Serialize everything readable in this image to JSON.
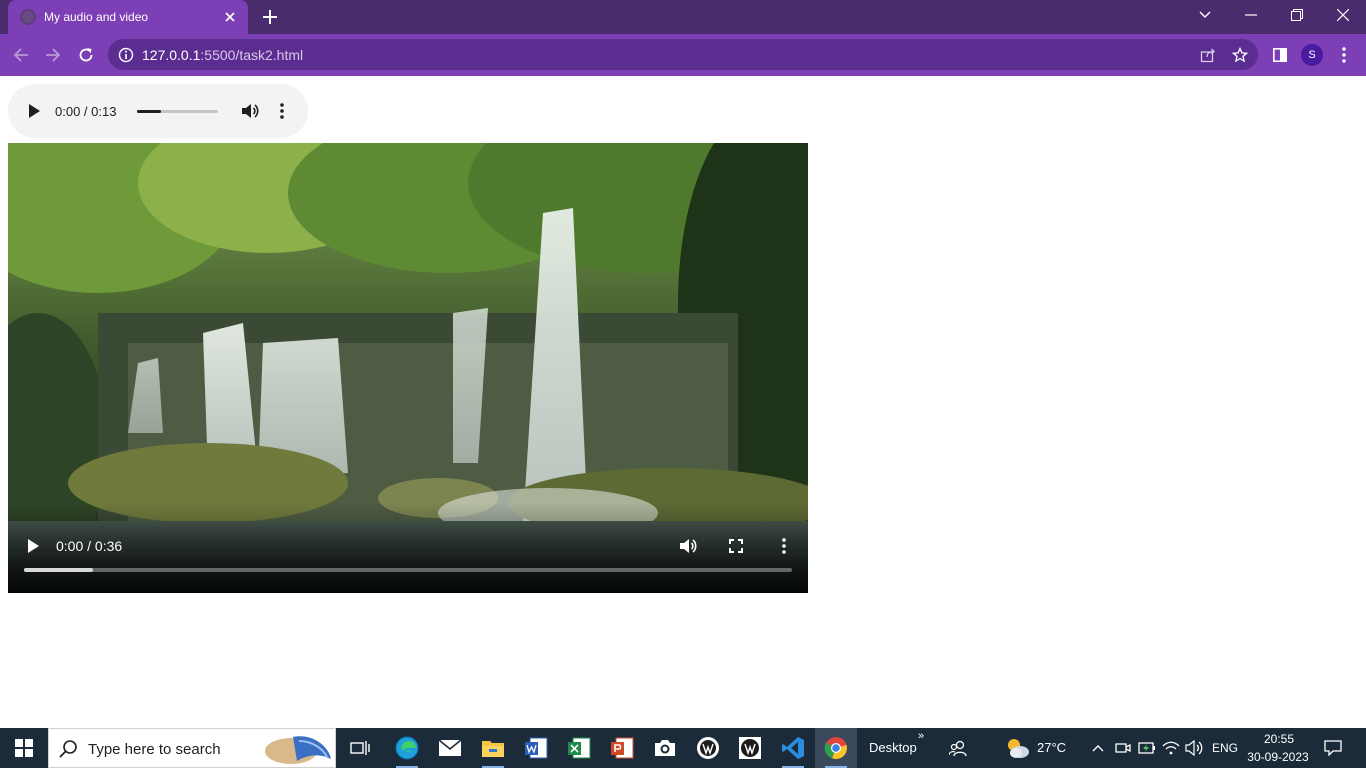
{
  "browser": {
    "tab_title": "My audio and video",
    "url_host": "127.0.0.1",
    "url_rest": ":5500/task2.html",
    "profile_initial": "S",
    "colors": {
      "tabstrip": "#4a2c6e",
      "toolbar": "#7d3fb5",
      "omnibox": "#5c2d91"
    }
  },
  "audio": {
    "time": "0:00 / 0:13",
    "buffered_fraction": 0.3
  },
  "video": {
    "time": "0:00 / 0:36",
    "buffered_fraction": 0.09,
    "scene": "waterfall"
  },
  "taskbar": {
    "search_placeholder": "Type here to search",
    "apps": [
      "task-view-icon",
      "edge-icon",
      "mail-icon",
      "file-explorer-icon",
      "word-icon",
      "excel-icon",
      "powerpoint-icon",
      "camera-icon",
      "wordpress-icon",
      "wordpress-alt-icon",
      "vscode-icon",
      "chrome-icon"
    ],
    "desktop_label": "Desktop",
    "weather_temp": "27°C",
    "language": "ENG",
    "time": "20:55",
    "date": "30-09-2023"
  }
}
